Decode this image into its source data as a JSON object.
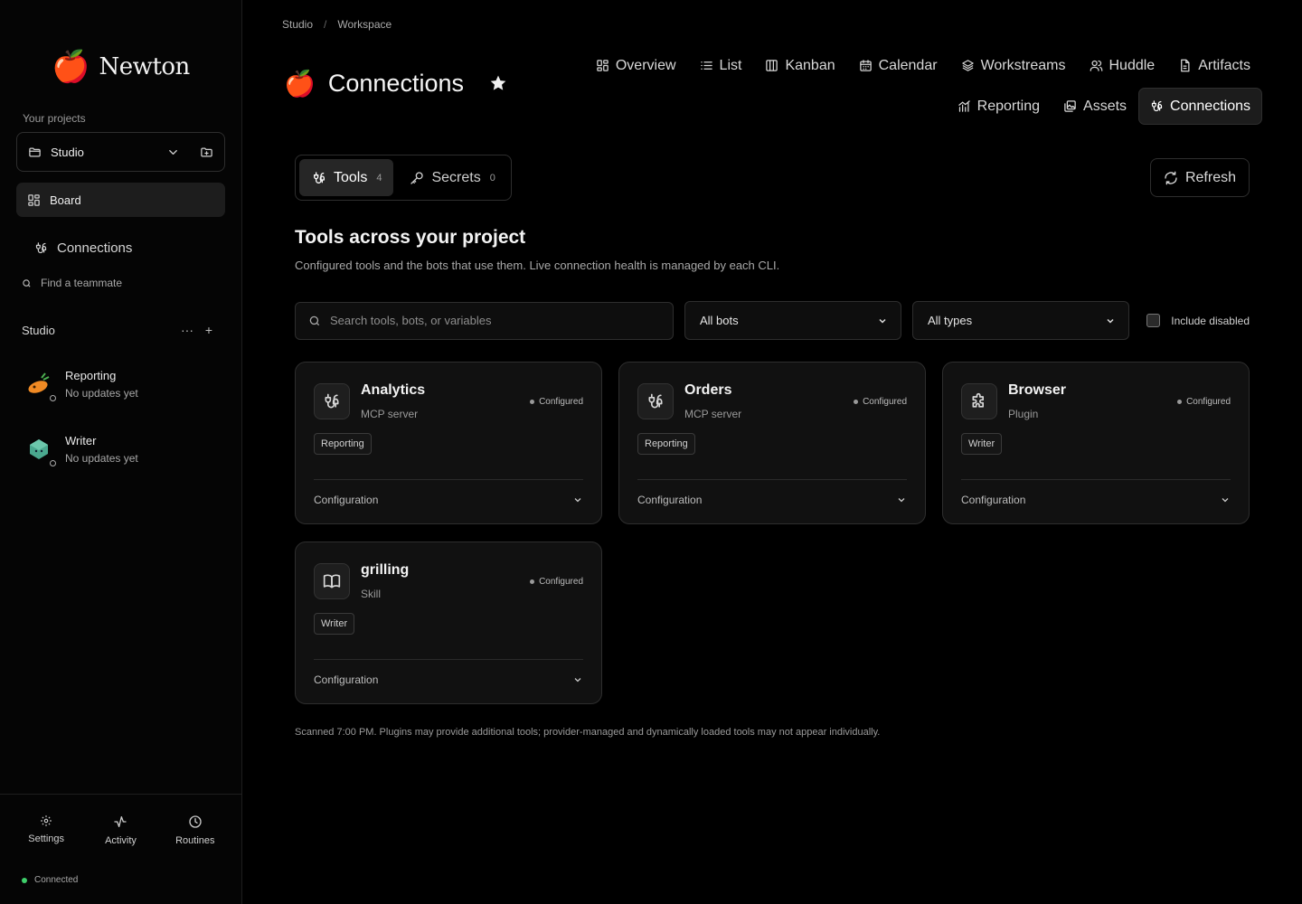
{
  "brand": {
    "name": "Newton",
    "logo": "🍎"
  },
  "sidebar": {
    "projects_label": "Your projects",
    "project": "Studio",
    "board": "Board",
    "connections": "Connections",
    "find_placeholder": "Find a teammate",
    "section": "Studio",
    "section_more": "···",
    "section_add": "+",
    "bots": [
      {
        "name": "Reporting",
        "status": "No updates yet"
      },
      {
        "name": "Writer",
        "status": "No updates yet"
      }
    ],
    "footer": {
      "settings": "Settings",
      "activity": "Activity",
      "routines": "Routines",
      "connection_status": "Connected"
    }
  },
  "breadcrumb": {
    "root": "Studio",
    "sep": "/",
    "current": "Workspace"
  },
  "page": {
    "icon": "🍎",
    "title": "Connections"
  },
  "view_tabs": [
    {
      "label": "Overview",
      "icon": "grid-icon"
    },
    {
      "label": "List",
      "icon": "list-icon"
    },
    {
      "label": "Kanban",
      "icon": "kanban-icon"
    },
    {
      "label": "Calendar",
      "icon": "calendar-icon"
    },
    {
      "label": "Workstreams",
      "icon": "layers-icon"
    },
    {
      "label": "Huddle",
      "icon": "users-icon"
    },
    {
      "label": "Artifacts",
      "icon": "document-icon"
    },
    {
      "label": "Reporting",
      "icon": "chart-icon"
    },
    {
      "label": "Assets",
      "icon": "images-icon"
    },
    {
      "label": "Connections",
      "icon": "plug-icon",
      "active": true
    }
  ],
  "segments": [
    {
      "label": "Tools",
      "count": "4",
      "active": true
    },
    {
      "label": "Secrets",
      "count": "0"
    }
  ],
  "refresh_label": "Refresh",
  "section": {
    "title": "Tools across your project",
    "subtitle": "Configured tools and the bots that use them. Live connection health is managed by each CLI."
  },
  "filters": {
    "search_placeholder": "Search tools, bots, or variables",
    "bots": "All bots",
    "types": "All types",
    "include_disabled": "Include disabled"
  },
  "tools": [
    {
      "name": "Analytics",
      "type": "MCP server",
      "status": "Configured",
      "tag": "Reporting",
      "footer": "Configuration",
      "icon": "plug-icon"
    },
    {
      "name": "Orders",
      "type": "MCP server",
      "status": "Configured",
      "tag": "Reporting",
      "footer": "Configuration",
      "icon": "plug-icon"
    },
    {
      "name": "Browser",
      "type": "Plugin",
      "status": "Configured",
      "tag": "Writer",
      "footer": "Configuration",
      "icon": "puzzle-icon"
    },
    {
      "name": "grilling",
      "type": "Skill",
      "status": "Configured",
      "tag": "Writer",
      "footer": "Configuration",
      "icon": "book-icon"
    }
  ],
  "note": "Scanned 7:00 PM. Plugins may provide additional tools; provider-managed and dynamically loaded tools may not appear individually.",
  "colors": {
    "background": "#000000",
    "panel": "#111111",
    "border": "#2e2e2e",
    "connected": "#3ecf6a"
  }
}
